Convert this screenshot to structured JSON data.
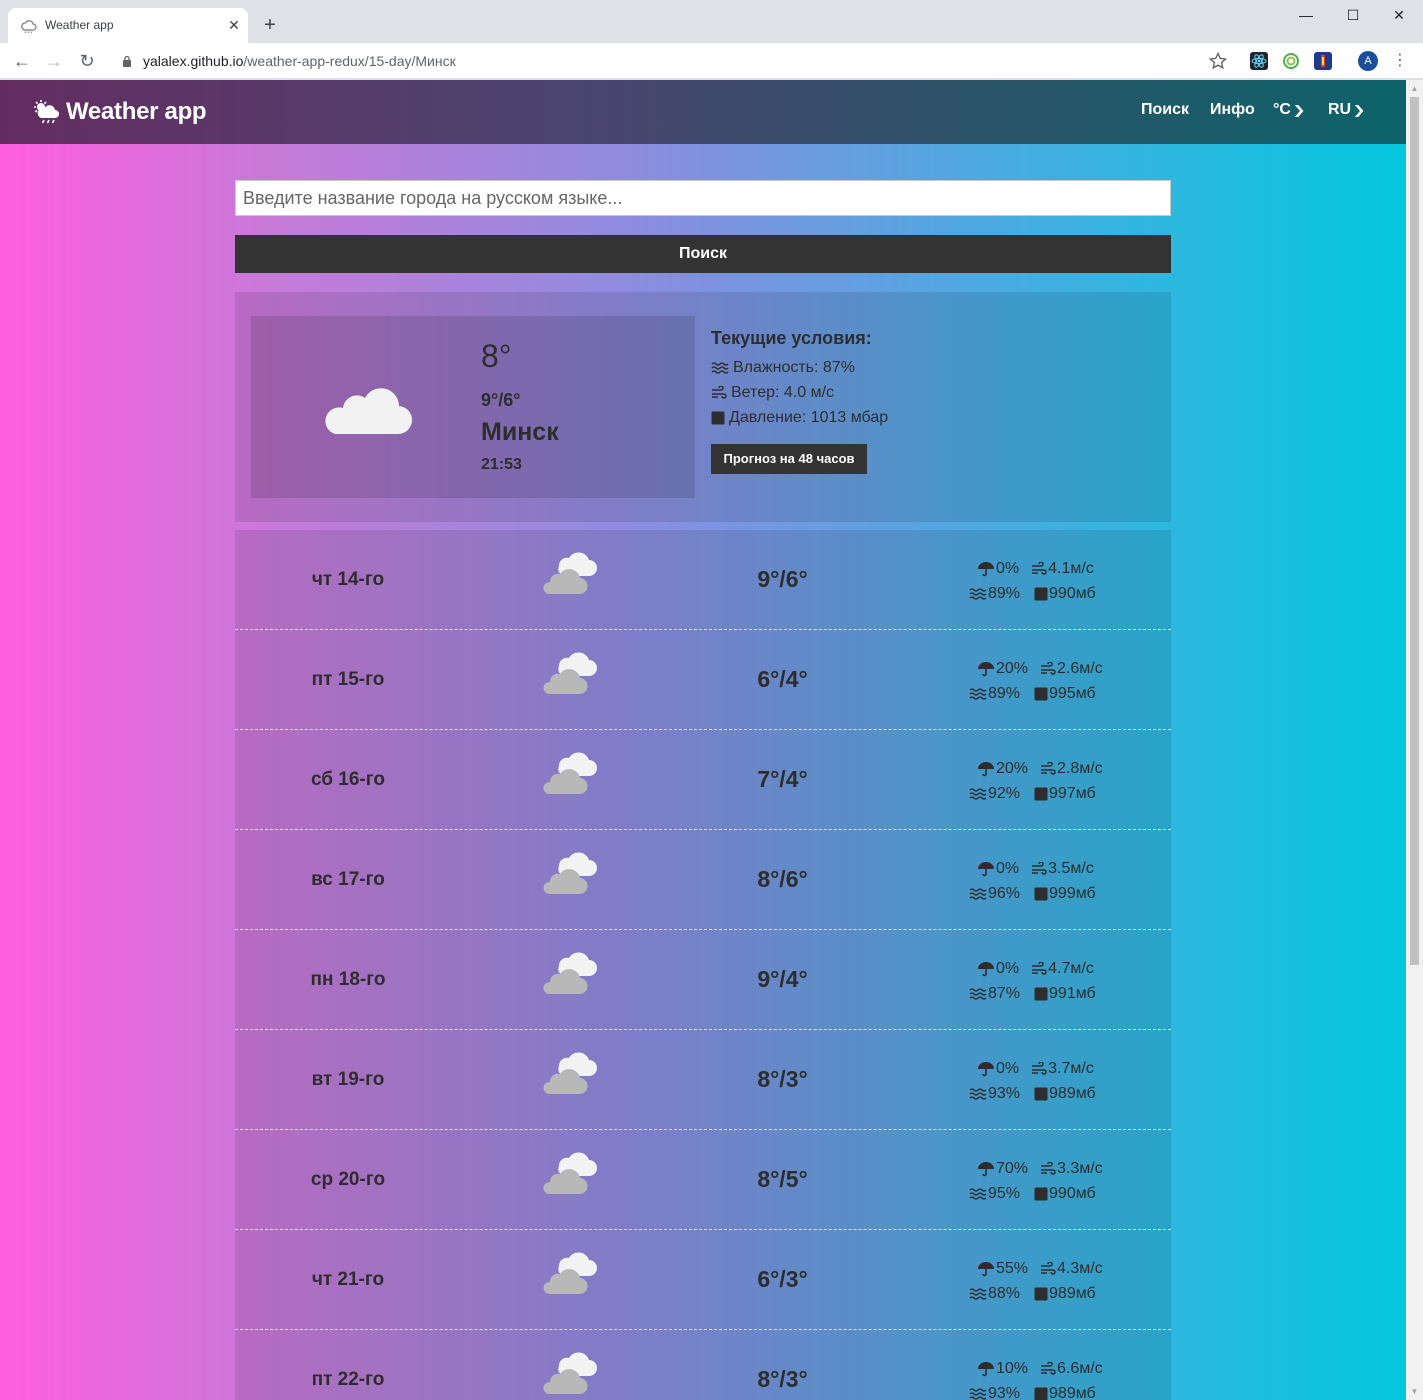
{
  "browser": {
    "tab_title": "Weather app",
    "url_host": "yalalex.github.io",
    "url_path": "/weather-app-redux/15-day/Минск",
    "profile_initial": "A"
  },
  "navbar": {
    "brand": "Weather app",
    "search_link": "Поиск",
    "info_link": "Инфо",
    "units_label": "°C",
    "lang_label": "RU"
  },
  "search": {
    "placeholder": "Введите название города на русском языке...",
    "value": "",
    "button_label": "Поиск"
  },
  "current": {
    "temp": "8°",
    "range": "9°/6°",
    "city": "Минск",
    "time": "21:53",
    "conditions_title": "Текущие условия:",
    "humidity_text": "Влажность: 87%",
    "wind_text": "Ветер: 4.0 м/с",
    "pressure_text": "Давление: 1013 мбар",
    "forecast_button": "Прогноз на 48 часов"
  },
  "days": [
    {
      "label": "чт 14-го",
      "temp": "9°/6°",
      "precip": "0%",
      "wind": "4.1м/с",
      "humidity": "89%",
      "pressure": "990мб"
    },
    {
      "label": "пт 15-го",
      "temp": "6°/4°",
      "precip": "20%",
      "wind": "2.6м/с",
      "humidity": "89%",
      "pressure": "995мб"
    },
    {
      "label": "сб 16-го",
      "temp": "7°/4°",
      "precip": "20%",
      "wind": "2.8м/с",
      "humidity": "92%",
      "pressure": "997мб"
    },
    {
      "label": "вс 17-го",
      "temp": "8°/6°",
      "precip": "0%",
      "wind": "3.5м/с",
      "humidity": "96%",
      "pressure": "999мб"
    },
    {
      "label": "пн 18-го",
      "temp": "9°/4°",
      "precip": "0%",
      "wind": "4.7м/с",
      "humidity": "87%",
      "pressure": "991мб"
    },
    {
      "label": "вт 19-го",
      "temp": "8°/3°",
      "precip": "0%",
      "wind": "3.7м/с",
      "humidity": "93%",
      "pressure": "989мб"
    },
    {
      "label": "ср 20-го",
      "temp": "8°/5°",
      "precip": "70%",
      "wind": "3.3м/с",
      "humidity": "95%",
      "pressure": "990мб"
    },
    {
      "label": "чт 21-го",
      "temp": "6°/3°",
      "precip": "55%",
      "wind": "4.3м/с",
      "humidity": "88%",
      "pressure": "989мб"
    },
    {
      "label": "пт 22-го",
      "temp": "8°/3°",
      "precip": "10%",
      "wind": "6.6м/с",
      "humidity": "93%",
      "pressure": "989мб"
    }
  ],
  "icons": {
    "favicon": "cloud-icon",
    "brand": "cloud-sun-rain-icon",
    "day_weather": "cloudy-icon",
    "precip": "umbrella-icon",
    "wind": "wind-icon",
    "humidity": "water-waves-icon",
    "pressure": "square-icon"
  },
  "colors": {
    "gradient_left": "#ff5edf",
    "gradient_right": "#04c8de",
    "button_dark": "#333333",
    "text_dark": "#2d2d2d"
  }
}
